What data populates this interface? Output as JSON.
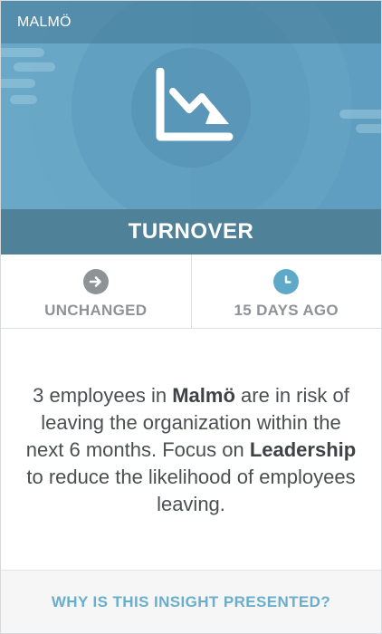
{
  "header": {
    "location": "MALMÖ",
    "title": "TURNOVER",
    "icon": "trend-down-icon"
  },
  "stats": [
    {
      "icon": "arrow-right-circle-icon",
      "icon_color": "#8e9396",
      "label": "UNCHANGED"
    },
    {
      "icon": "clock-icon",
      "icon_color": "#5ea9c8",
      "label": "15 DAYS AGO"
    }
  ],
  "message": {
    "part1": "3 employees in ",
    "location": "Malmö",
    "part2": " are in risk of leaving the organization within the next 6 months. Focus on ",
    "focus": "Leadership",
    "part3": " to reduce the likelihood of employees leaving."
  },
  "footer": {
    "link_label": "WHY IS THIS INSIGHT PRESENTED?"
  },
  "colors": {
    "hero": "#5f9ec0",
    "title_bar": "#4f8198",
    "link": "#6aaecb"
  }
}
